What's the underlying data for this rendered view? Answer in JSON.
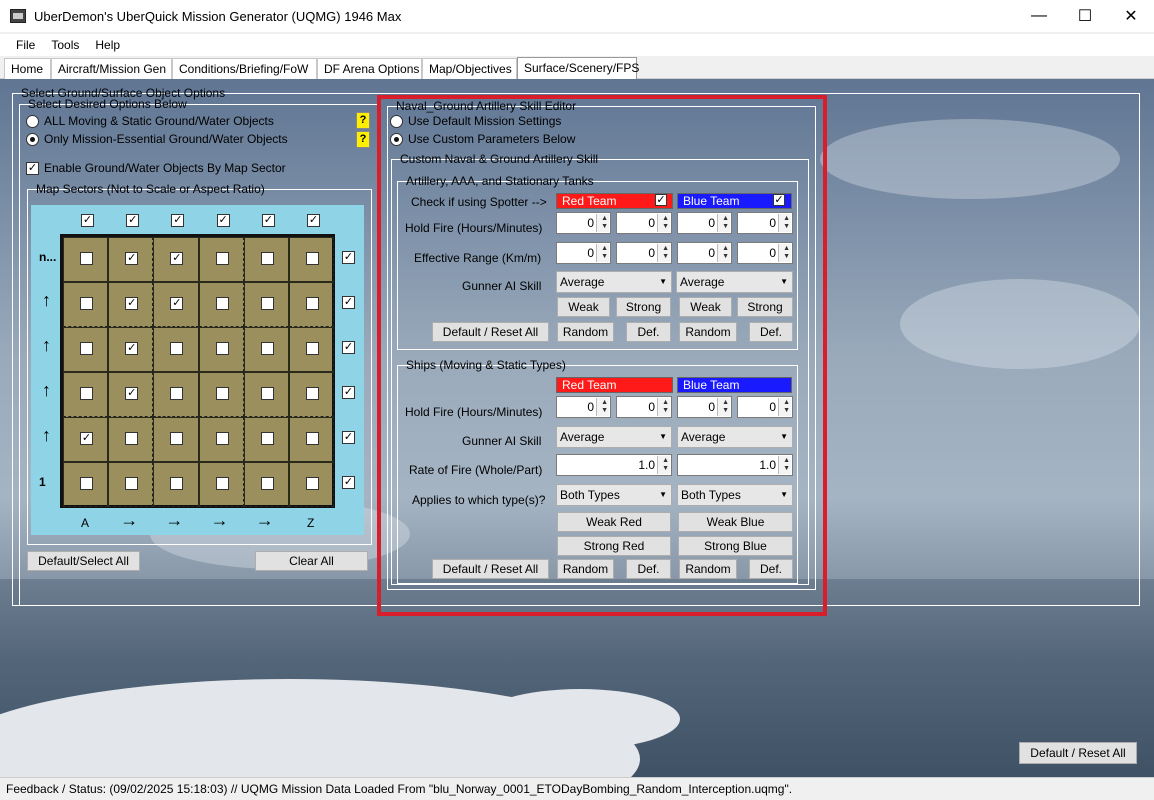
{
  "window": {
    "title": "UberDemon's UberQuick Mission Generator (UQMG) 1946 Max",
    "minimize": "—",
    "maximize": "☐",
    "close": "✕"
  },
  "menu": [
    "File",
    "Tools",
    "Help"
  ],
  "tabs": [
    "Home",
    "Aircraft/Mission Gen",
    "Conditions/Briefing/FoW",
    "DF Arena Options",
    "Map/Objectives",
    "Surface/Scenery/FPS"
  ],
  "active_tab": "Surface/Scenery/FPS",
  "surface": {
    "group_title": "Select Ground/Surface Object Options",
    "desired_title": "Select Desired Options Below",
    "opt_all": "ALL Moving & Static Ground/Water Objects",
    "opt_essential": "Only Mission-Essential Ground/Water Objects",
    "help": "?",
    "enable_label": "Enable Ground/Water Objects By Map Sector",
    "sectors_title": "Map Sectors (Not to Scale or Aspect Ratio)",
    "row_labels": [
      "n...",
      "↑",
      "↑",
      "↑",
      "↑",
      "1"
    ],
    "col_labels": [
      "A",
      "→",
      "→",
      "→",
      "→",
      "Z"
    ],
    "checked_cells": [
      [
        0,
        1
      ],
      [
        0,
        2
      ],
      [
        1,
        1
      ],
      [
        1,
        2
      ],
      [
        2,
        1
      ],
      [
        3,
        1
      ],
      [
        4,
        0
      ]
    ],
    "default_select_all": "Default/Select All",
    "clear_all": "Clear All"
  },
  "editor": {
    "title": "Naval_Ground Artillery Skill Editor",
    "use_default": "Use Default Mission Settings",
    "use_custom": "Use Custom Parameters Below",
    "custom_title": "Custom Naval & Ground Artillery Skill",
    "art_title": "Artillery, AAA, and Stationary Tanks",
    "spotter_label": "Check if using Spotter -->",
    "red_team": "Red Team",
    "blue_team": "Blue Team",
    "red_color": "#ff1a1a",
    "blue_color": "#1a1aff",
    "hold_fire": "Hold Fire (Hours/Minutes)",
    "eff_range": "Effective Range (Km/m)",
    "gunner_skill": "Gunner AI Skill",
    "zero": "0",
    "average": "Average",
    "weak": "Weak",
    "strong": "Strong",
    "reset": "Default / Reset All",
    "random": "Random",
    "def": "Def.",
    "ships_title": "Ships (Moving & Static Types)",
    "rate_fire": "Rate of Fire (Whole/Part)",
    "rate_val": "1.0",
    "applies": "Applies to which type(s)?",
    "both_types": "Both Types",
    "weak_red": "Weak Red",
    "weak_blue": "Weak Blue",
    "strong_red": "Strong Red",
    "strong_blue": "Strong Blue"
  },
  "page_reset": "Default / Reset All",
  "status": "Feedback / Status:  (09/02/2025 15:18:03) // UQMG Mission Data Loaded From \"blu_Norway_0001_ETODayBombing_Random_Interception.uqmg\"."
}
